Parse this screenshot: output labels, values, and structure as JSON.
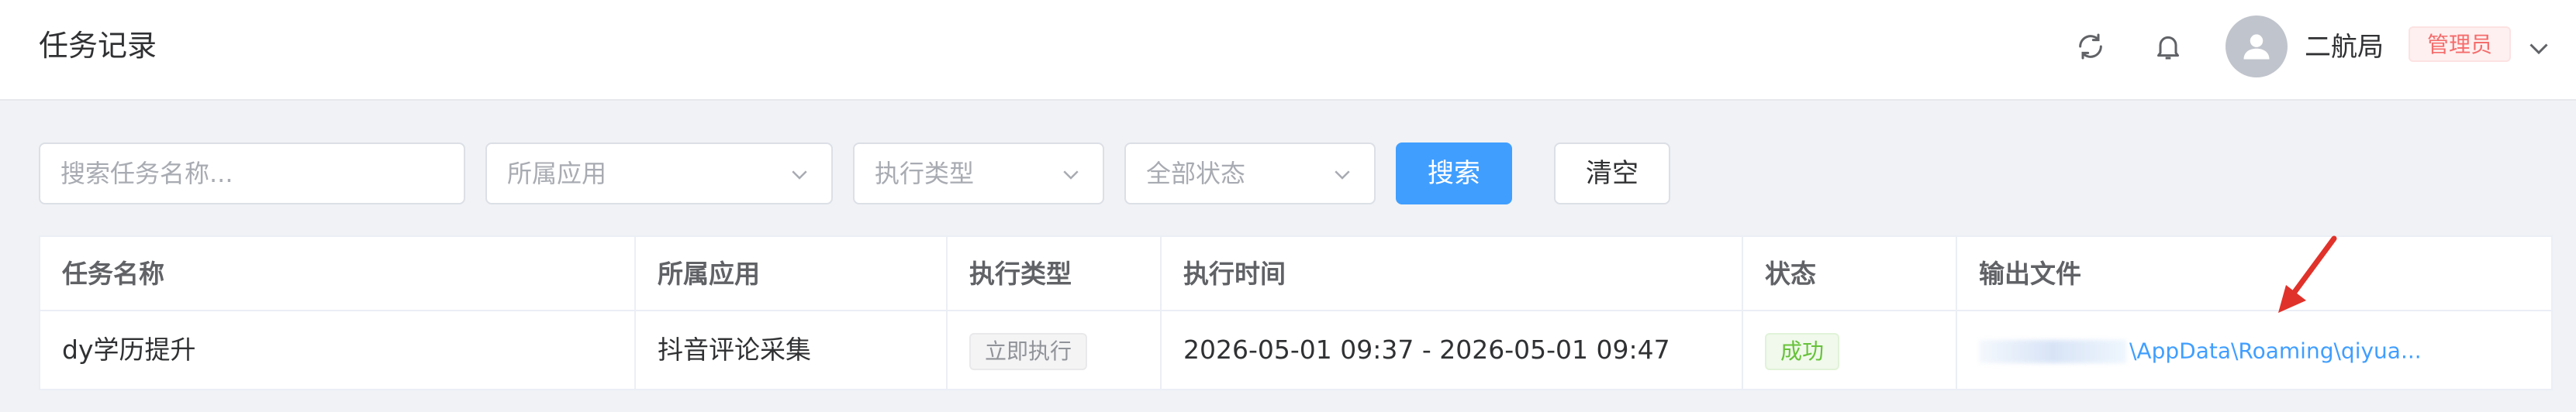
{
  "header": {
    "title": "任务记录",
    "refresh_icon": "refresh-icon",
    "bell_icon": "bell-icon",
    "avatar_icon": "user-avatar-icon",
    "username": "二航局",
    "role": "管理员",
    "caret_icon": "chevron-down-icon"
  },
  "filters": {
    "search_placeholder": "搜索任务名称...",
    "app_select": "所属应用",
    "type_select": "执行类型",
    "status_select": "全部状态",
    "search_button": "搜索",
    "clear_button": "清空"
  },
  "table": {
    "columns": [
      "任务名称",
      "所属应用",
      "执行类型",
      "执行时间",
      "状态",
      "输出文件"
    ],
    "rows": [
      {
        "name": "dy学历提升",
        "app": "抖音评论采集",
        "type": "立即执行",
        "time": "2026-05-01 09:37 - 2026-05-01 09:47",
        "status": "成功",
        "output": "\\AppData\\Roaming\\qiyua..."
      }
    ]
  },
  "colors": {
    "primary": "#409eff",
    "success": "#67c23a",
    "danger": "#f56c6c",
    "annotation_arrow": "#e0322a"
  }
}
